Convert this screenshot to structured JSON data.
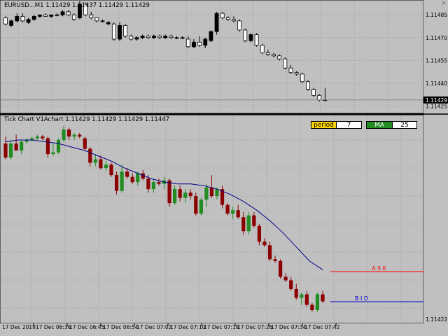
{
  "main_chart": {
    "title": "EURUSD...M1  1.11429 1.11437 1.11429 1.11429",
    "close_icon": "close-icon",
    "price_labels": [
      "1.11485",
      "1.11470",
      "1.11455",
      "1.11440",
      "1.11425"
    ],
    "current_price": "1.11429",
    "candles": [
      [
        1.11483,
        1.11484,
        1.11478,
        1.11479
      ],
      [
        1.11478,
        1.11482,
        1.11477,
        1.11481
      ],
      [
        1.11481,
        1.11486,
        1.1148,
        1.11484
      ],
      [
        1.11484,
        1.11486,
        1.1148,
        1.11481
      ],
      [
        1.1148,
        1.11483,
        1.11479,
        1.11482
      ],
      [
        1.11482,
        1.11485,
        1.11481,
        1.11484
      ],
      [
        1.11484,
        1.11485,
        1.11483,
        1.11485
      ],
      [
        1.11485,
        1.11486,
        1.11484,
        1.11484
      ],
      [
        1.11484,
        1.11485,
        1.11483,
        1.11485
      ],
      [
        1.11485,
        1.11486,
        1.11484,
        1.11485
      ],
      [
        1.11485,
        1.11488,
        1.11484,
        1.11487
      ],
      [
        1.11487,
        1.11488,
        1.11484,
        1.11485
      ],
      [
        1.11485,
        1.11486,
        1.11481,
        1.11482
      ],
      [
        1.11483,
        1.11494,
        1.11482,
        1.11492
      ],
      [
        1.11492,
        1.11493,
        1.11484,
        1.11485
      ],
      [
        1.11485,
        1.11487,
        1.11482,
        1.11483
      ],
      [
        1.11483,
        1.11483,
        1.1148,
        1.11481
      ],
      [
        1.11481,
        1.11482,
        1.1148,
        1.11481
      ],
      [
        1.11479,
        1.11481,
        1.11478,
        1.1148
      ],
      [
        1.11479,
        1.1148,
        1.11468,
        1.11469
      ],
      [
        1.11469,
        1.1148,
        1.11468,
        1.11478
      ],
      [
        1.11478,
        1.11479,
        1.1147,
        1.11471
      ],
      [
        1.11471,
        1.11472,
        1.11468,
        1.11469
      ],
      [
        1.11469,
        1.11471,
        1.11468,
        1.1147
      ],
      [
        1.1147,
        1.11472,
        1.11469,
        1.11471
      ],
      [
        1.11471,
        1.11472,
        1.11469,
        1.1147
      ],
      [
        1.1147,
        1.11472,
        1.11469,
        1.11471
      ],
      [
        1.11471,
        1.11472,
        1.11469,
        1.1147
      ],
      [
        1.1147,
        1.11472,
        1.11469,
        1.11471
      ],
      [
        1.11471,
        1.11472,
        1.11469,
        1.1147
      ],
      [
        1.1147,
        1.11471,
        1.11469,
        1.1147
      ],
      [
        1.1147,
        1.11471,
        1.11469,
        1.1147
      ],
      [
        1.11469,
        1.11471,
        1.11463,
        1.11464
      ],
      [
        1.11464,
        1.11469,
        1.11463,
        1.11467
      ],
      [
        1.11467,
        1.11471,
        1.11464,
        1.11465
      ],
      [
        1.11465,
        1.1147,
        1.11463,
        1.11469
      ],
      [
        1.11468,
        1.11475,
        1.11467,
        1.11474
      ],
      [
        1.11474,
        1.11487,
        1.11472,
        1.11486
      ],
      [
        1.11486,
        1.11487,
        1.11482,
        1.11483
      ],
      [
        1.11483,
        1.11484,
        1.11481,
        1.11482
      ],
      [
        1.11482,
        1.11484,
        1.1148,
        1.11481
      ],
      [
        1.11481,
        1.11482,
        1.11474,
        1.11475
      ],
      [
        1.11475,
        1.11476,
        1.11467,
        1.11468
      ],
      [
        1.11468,
        1.11473,
        1.11467,
        1.11472
      ],
      [
        1.11472,
        1.11473,
        1.11464,
        1.11465
      ],
      [
        1.11465,
        1.11466,
        1.11459,
        1.1146
      ],
      [
        1.1146,
        1.11462,
        1.11458,
        1.11459
      ],
      [
        1.11459,
        1.1146,
        1.11457,
        1.11458
      ],
      [
        1.11458,
        1.11459,
        1.11455,
        1.11456
      ],
      [
        1.11456,
        1.11457,
        1.11449,
        1.1145
      ],
      [
        1.1145,
        1.11452,
        1.11446,
        1.11447
      ],
      [
        1.11447,
        1.11448,
        1.11445,
        1.11446
      ],
      [
        1.11446,
        1.11447,
        1.1144,
        1.11441
      ],
      [
        1.11441,
        1.11442,
        1.11435,
        1.11436
      ],
      [
        1.11436,
        1.11437,
        1.11431,
        1.11432
      ],
      [
        1.11432,
        1.11433,
        1.11428,
        1.11429
      ],
      [
        1.11429,
        1.11437,
        1.11429,
        1.11429
      ]
    ]
  },
  "tick_chart": {
    "title": "Tick Chart V1Achart  1.11429 1.11429 1.11429 1.11447",
    "params": [
      {
        "label": "period",
        "value": "7",
        "color": "#ffd700"
      },
      {
        "label": "MA",
        "value": "25",
        "color": "#228b22"
      }
    ],
    "ask_label": "A S K",
    "bid_label": "B I D",
    "price_label": "1.11422",
    "time_labels": [
      "17 Dec 2019",
      "17 Dec 06:36",
      "17 Dec 06:45",
      "17 Dec 06:54",
      "17 Dec 07:02",
      "17 Dec 07:10",
      "17 Dec 07:18",
      "17 Dec 07:26",
      "17 Dec 07:34",
      "17 Dec 07:42"
    ],
    "bull_color": "#228b22",
    "bear_color": "#8b0000",
    "ma_color": "#00008b",
    "ask_color": "#ff0000",
    "bid_color": "#0000cd",
    "candles": [
      [
        1.11472,
        1.11476,
        1.11463,
        1.11464
      ],
      [
        1.11464,
        1.11474,
        1.11463,
        1.11472
      ],
      [
        1.11472,
        1.11477,
        1.1147,
        1.11468
      ],
      [
        1.11468,
        1.11474,
        1.11466,
        1.11473
      ],
      [
        1.11473,
        1.11475,
        1.11472,
        1.11474
      ],
      [
        1.11474,
        1.11476,
        1.11473,
        1.11475
      ],
      [
        1.11475,
        1.11477,
        1.11474,
        1.11476
      ],
      [
        1.11476,
        1.11477,
        1.11474,
        1.11475
      ],
      [
        1.11475,
        1.11476,
        1.11464,
        1.11466
      ],
      [
        1.11466,
        1.11472,
        1.11465,
        1.11467
      ],
      [
        1.11467,
        1.11475,
        1.11466,
        1.11474
      ],
      [
        1.11474,
        1.11482,
        1.11473,
        1.1148
      ],
      [
        1.1148,
        1.11481,
        1.11474,
        1.11476
      ],
      [
        1.11476,
        1.11478,
        1.11474,
        1.11477
      ],
      [
        1.11477,
        1.11478,
        1.11475,
        1.11476
      ],
      [
        1.11475,
        1.11476,
        1.11468,
        1.11469
      ],
      [
        1.11469,
        1.1147,
        1.11459,
        1.11461
      ],
      [
        1.11461,
        1.11466,
        1.11459,
        1.11463
      ],
      [
        1.11463,
        1.11465,
        1.11457,
        1.11458
      ],
      [
        1.11458,
        1.11462,
        1.11456,
        1.1146
      ],
      [
        1.1146,
        1.11461,
        1.11453,
        1.11454
      ],
      [
        1.11454,
        1.11456,
        1.11443,
        1.11445
      ],
      [
        1.11445,
        1.1146,
        1.11444,
        1.11456
      ],
      [
        1.11456,
        1.11458,
        1.11452,
        1.11453
      ],
      [
        1.11453,
        1.11455,
        1.11449,
        1.1145
      ],
      [
        1.1145,
        1.11456,
        1.11448,
        1.11455
      ],
      [
        1.11455,
        1.11457,
        1.11451,
        1.11452
      ],
      [
        1.11452,
        1.11454,
        1.11444,
        1.11446
      ],
      [
        1.11446,
        1.11452,
        1.11444,
        1.1145
      ],
      [
        1.1145,
        1.11452,
        1.11448,
        1.11449
      ],
      [
        1.11449,
        1.11453,
        1.11446,
        1.11451
      ],
      [
        1.11451,
        1.11452,
        1.11436,
        1.11438
      ],
      [
        1.11438,
        1.11448,
        1.11437,
        1.11446
      ],
      [
        1.11446,
        1.11448,
        1.11439,
        1.11441
      ],
      [
        1.11441,
        1.11446,
        1.11438,
        1.11444
      ],
      [
        1.11444,
        1.11446,
        1.1144,
        1.11442
      ],
      [
        1.11442,
        1.11444,
        1.11431,
        1.11432
      ],
      [
        1.11432,
        1.11441,
        1.11431,
        1.1144
      ],
      [
        1.1144,
        1.11449,
        1.11436,
        1.11447
      ],
      [
        1.11447,
        1.11454,
        1.11441,
        1.11442
      ],
      [
        1.11442,
        1.11447,
        1.1144,
        1.11446
      ],
      [
        1.11446,
        1.11448,
        1.11435,
        1.11437
      ],
      [
        1.11437,
        1.11438,
        1.11431,
        1.11432
      ],
      [
        1.11432,
        1.11436,
        1.11429,
        1.11434
      ],
      [
        1.11434,
        1.11437,
        1.11429,
        1.1143
      ],
      [
        1.1143,
        1.11433,
        1.1142,
        1.11422
      ],
      [
        1.11422,
        1.11433,
        1.1142,
        1.11431
      ],
      [
        1.11431,
        1.11433,
        1.11424,
        1.11425
      ],
      [
        1.11425,
        1.11426,
        1.11414,
        1.11416
      ],
      [
        1.11416,
        1.11418,
        1.11413,
        1.11414
      ],
      [
        1.11414,
        1.11416,
        1.11405,
        1.11406
      ],
      [
        1.11406,
        1.11408,
        1.11404,
        1.11405
      ],
      [
        1.11405,
        1.11406,
        1.11395,
        1.11396
      ],
      [
        1.11396,
        1.11398,
        1.11393,
        1.11394
      ],
      [
        1.11394,
        1.11396,
        1.11388,
        1.11389
      ],
      [
        1.11389,
        1.11392,
        1.11383,
        1.11384
      ],
      [
        1.11384,
        1.11387,
        1.1138,
        1.11386
      ],
      [
        1.11386,
        1.11388,
        1.11379,
        1.1138
      ],
      [
        1.1138,
        1.11381,
        1.11376,
        1.11377
      ],
      [
        1.11377,
        1.11387,
        1.11376,
        1.11386
      ],
      [
        1.11386,
        1.11388,
        1.11381,
        1.11382
      ]
    ],
    "ma": [
      1.11473,
      1.11474,
      1.11474,
      1.11473,
      1.11472,
      1.1147,
      1.11468,
      1.11465,
      1.11462,
      1.11458,
      1.11455,
      1.11452,
      1.1145,
      1.11449,
      1.11449,
      1.11448,
      1.11446,
      1.11443,
      1.11439,
      1.11434,
      1.11428,
      1.11421,
      1.11413,
      1.11405,
      1.114
    ]
  }
}
